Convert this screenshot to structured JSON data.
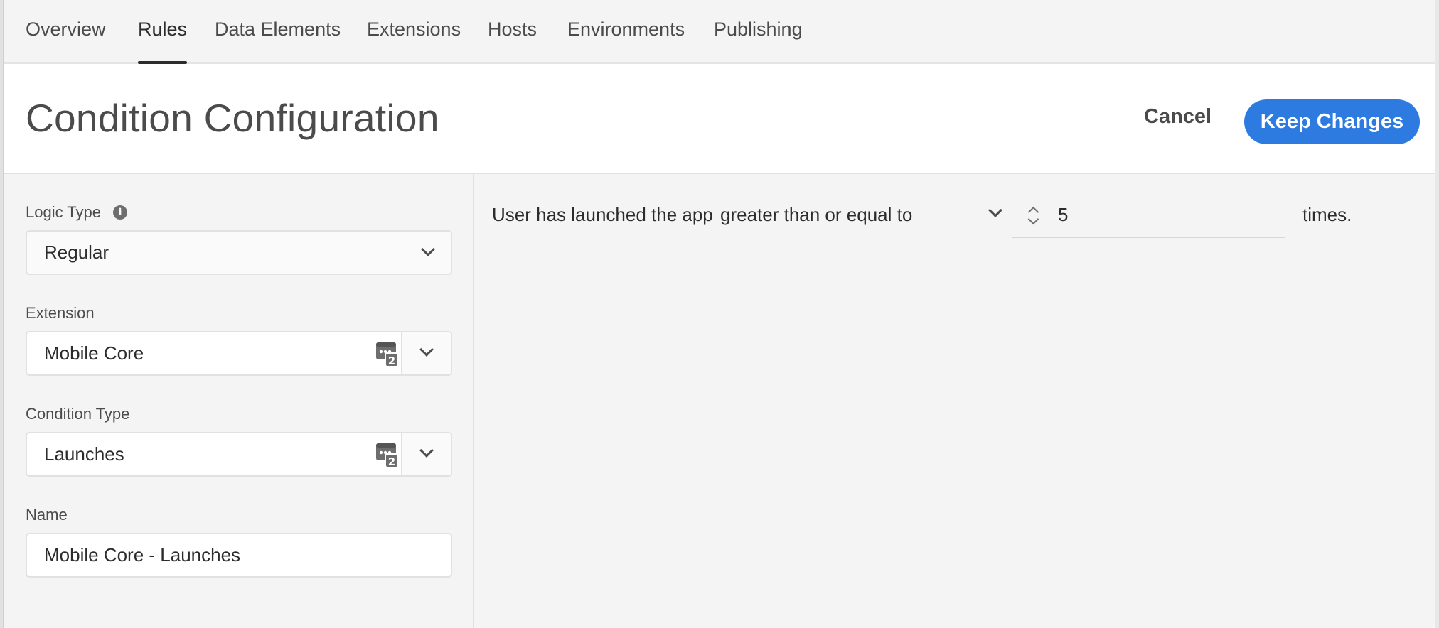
{
  "tabs": [
    {
      "label": "Overview"
    },
    {
      "label": "Rules"
    },
    {
      "label": "Data Elements"
    },
    {
      "label": "Extensions"
    },
    {
      "label": "Hosts"
    },
    {
      "label": "Environments"
    },
    {
      "label": "Publishing"
    }
  ],
  "active_tab": "Rules",
  "header": {
    "title": "Condition Configuration",
    "cancel_label": "Cancel",
    "keep_label": "Keep Changes",
    "accent_color": "#2d7be0"
  },
  "form": {
    "logic_type": {
      "label": "Logic Type",
      "value": "Regular",
      "info_icon": "info-icon"
    },
    "extension": {
      "label": "Extension",
      "value": "Mobile Core",
      "icon": "data-element-icon",
      "icon_badge": "2"
    },
    "condition_type": {
      "label": "Condition Type",
      "value": "Launches",
      "icon": "data-element-icon",
      "icon_badge": "2"
    },
    "name": {
      "label": "Name",
      "value": "Mobile Core - Launches"
    }
  },
  "condition": {
    "prefix": "User has launched the app",
    "operator": "greater than or equal to",
    "count": "5",
    "suffix": "times."
  }
}
